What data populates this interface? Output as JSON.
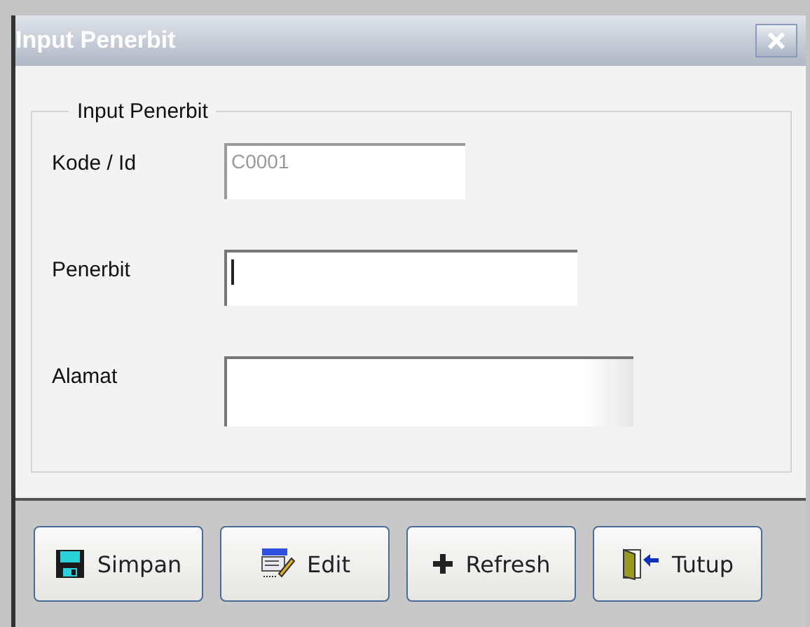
{
  "window": {
    "title": "Input Penerbit"
  },
  "group": {
    "title": "Input Penerbit"
  },
  "fields": [
    {
      "label": "Kode / Id",
      "kind": "text",
      "value": "C0001",
      "disabled": true,
      "focused": false
    },
    {
      "label": "Penerbit",
      "kind": "text",
      "disabled": false,
      "focused": true
    },
    {
      "label": "Alamat",
      "kind": "textarea",
      "disabled": false,
      "focused": false
    }
  ],
  "buttons": [
    "Simpan",
    "Edit",
    "Refresh",
    "Tutup"
  ]
}
